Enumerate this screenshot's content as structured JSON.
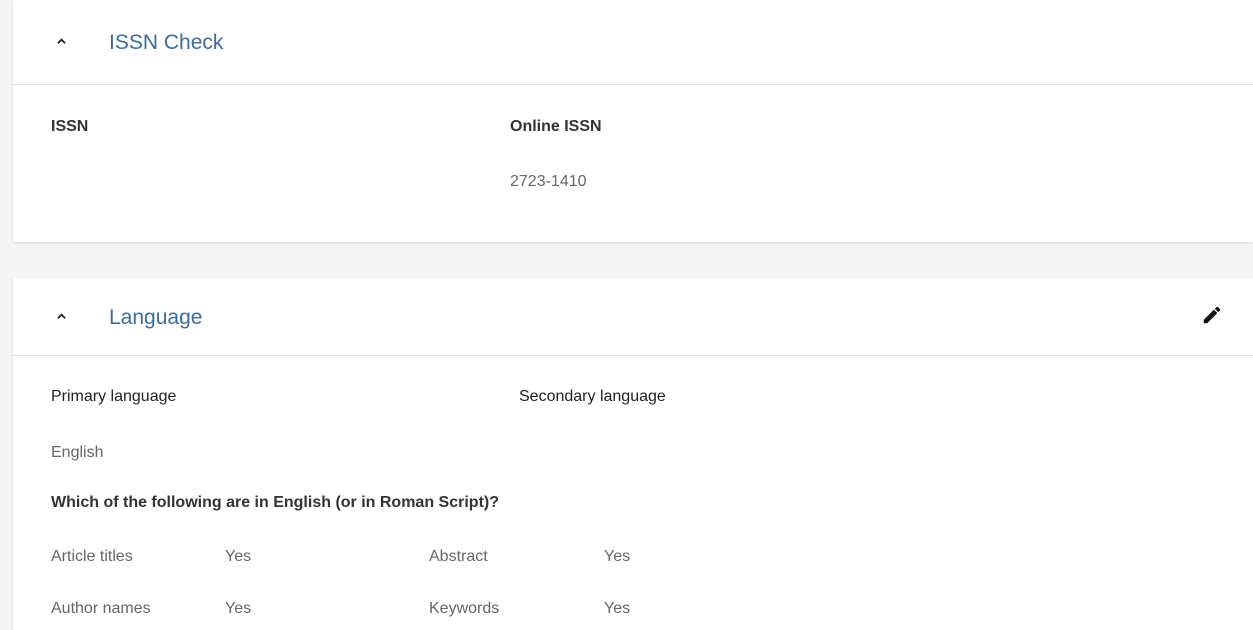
{
  "issn_section": {
    "title": "ISSN Check",
    "issn_label": "ISSN",
    "online_issn_label": "Online ISSN",
    "online_issn_value": "2723-1410"
  },
  "language_section": {
    "title": "Language",
    "primary_label": "Primary language",
    "secondary_label": "Secondary language",
    "primary_value": "English",
    "question": "Which of the following are in English (or in Roman Script)?",
    "rows": [
      {
        "label": "Article titles",
        "value": "Yes"
      },
      {
        "label": "Abstract",
        "value": "Yes"
      },
      {
        "label": "Author names",
        "value": "Yes"
      },
      {
        "label": "Keywords",
        "value": "Yes"
      }
    ]
  },
  "icons": {
    "collapse": "chevron-up-icon",
    "edit": "pencil-icon"
  }
}
